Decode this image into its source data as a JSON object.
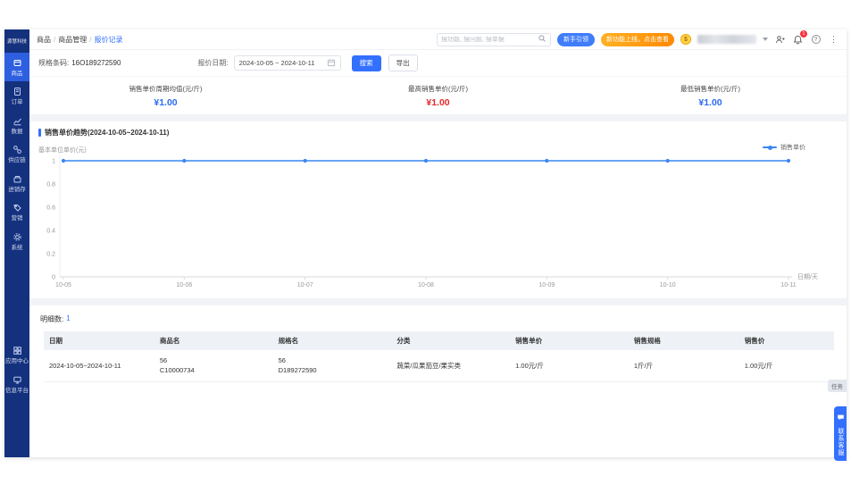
{
  "brand": "源慧科技",
  "sidebar": {
    "items": [
      {
        "label": "商品",
        "icon": "goods-box-icon",
        "active": true
      },
      {
        "label": "订单",
        "icon": "order-doc-icon",
        "active": false
      },
      {
        "label": "数据",
        "icon": "data-chart-icon",
        "active": false
      },
      {
        "label": "供应链",
        "icon": "supply-chain-icon",
        "active": false
      },
      {
        "label": "进销存",
        "icon": "inventory-icon",
        "active": false
      },
      {
        "label": "营销",
        "icon": "marketing-tag-icon",
        "active": false
      },
      {
        "label": "系统",
        "icon": "system-gear-icon",
        "active": false
      },
      {
        "label": "应用中心",
        "icon": "app-center-grid-icon",
        "active": false
      },
      {
        "label": "信息平台",
        "icon": "info-platform-icon",
        "active": false
      }
    ]
  },
  "header": {
    "breadcrumb": {
      "items": [
        "商品",
        "商品管理",
        "报价记录"
      ],
      "separator": "/"
    },
    "search_placeholder": "搜功能, 搜问题, 搜单据",
    "newbie_button": "新手引领",
    "new_feature_button": "新功能上线，点击查看",
    "bell_badge": "1",
    "icons": {
      "coin": "$",
      "help": "?",
      "more": "⋮"
    }
  },
  "toolbar": {
    "spec_label": "规格条码:",
    "spec_value": "16O189272590",
    "date_label": "报价日期:",
    "date_value": "2024-10-05 ~ 2024-10-11",
    "search_button": "搜索",
    "export_button": "导出"
  },
  "stats": {
    "items": [
      {
        "label": "销售单价周期均值(元/斤)",
        "value": "¥1.00",
        "color": "#2b6bf3"
      },
      {
        "label": "最高销售单价(元/斤)",
        "value": "¥1.00",
        "color": "#e12b2b"
      },
      {
        "label": "最低销售单价(元/斤)",
        "value": "¥1.00",
        "color": "#2b6bf3"
      }
    ]
  },
  "chart_data": {
    "type": "line",
    "title": "销售单价趋势(2024-10-05~2024-10-11)",
    "legend": [
      "销售单价"
    ],
    "legend_position": "top-right",
    "ylabel": "基本单位单价(元)",
    "xlabel": "日期/天",
    "x": [
      "10-05",
      "10-06",
      "10-07",
      "10-08",
      "10-09",
      "10-10",
      "10-11"
    ],
    "series": [
      {
        "name": "销售单价",
        "values": [
          1,
          1,
          1,
          1,
          1,
          1,
          1
        ]
      }
    ],
    "ylim": [
      0,
      1
    ],
    "yticks": [
      0,
      0.2,
      0.4,
      0.6,
      0.8,
      1
    ],
    "grid": false,
    "line_color": "#3a86f2"
  },
  "details": {
    "count_label": "明细数:",
    "count": "1",
    "table": {
      "headers": [
        "日期",
        "商品名",
        "规格名",
        "分类",
        "销售单价",
        "销售规格",
        "销售价"
      ],
      "rows": [
        {
          "date": "2024-10-05~2024-10-11",
          "product_line1": "56",
          "product_line2": "C10000734",
          "spec_line1": "56",
          "spec_line2": "D189272590",
          "category": "蔬菜/瓜果茄豆/果实类",
          "unit_price": "1.00元/斤",
          "sale_spec": "1斤/斤",
          "sale_price": "1.00元/斤"
        }
      ]
    }
  },
  "floating": {
    "task": "任务",
    "service": "联系客服"
  }
}
